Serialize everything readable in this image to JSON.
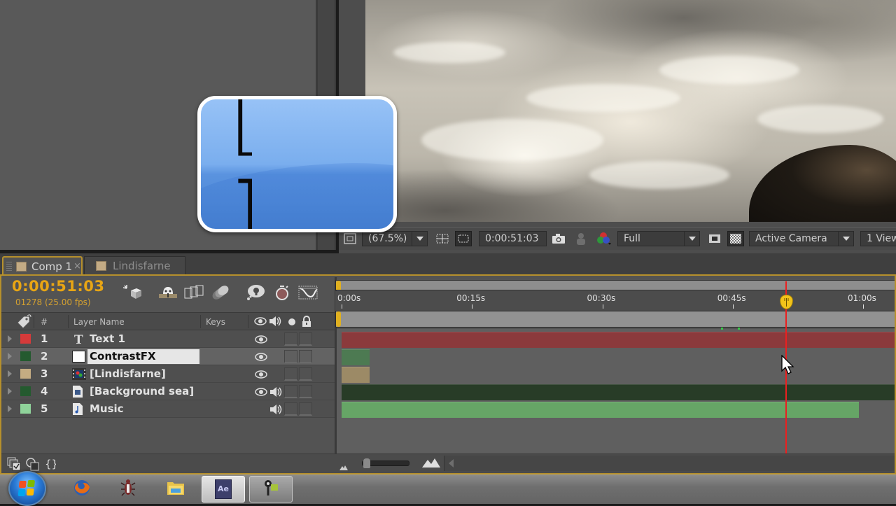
{
  "viewer": {
    "zoom_label": "(67.5%)",
    "timecode": "0:00:51:03",
    "resolution": "Full",
    "camera": "Active Camera",
    "views": "1 View"
  },
  "overlay": {
    "key_hint": "[   ]"
  },
  "tabs": [
    {
      "label": "Comp 1",
      "active": true,
      "close": "×"
    },
    {
      "label": "Lindisfarne",
      "active": false
    }
  ],
  "timeline": {
    "current_time": "0:00:51:03",
    "frame_info": "01278 (25.00 fps)",
    "columns": {
      "number": "#",
      "layer_name": "Layer Name",
      "keys": "Keys"
    },
    "ruler": {
      "ticks": [
        "0:00s",
        "00:15s",
        "00:30s",
        "00:45s",
        "01:00s"
      ],
      "tick_seconds": [
        0,
        15,
        30,
        45,
        60
      ],
      "playhead_seconds": 51.12,
      "visible_range_seconds": [
        0,
        64
      ]
    },
    "layers": [
      {
        "num": "1",
        "name": "Text 1",
        "type": "text",
        "label_color": "#d63a3a",
        "bar_color": "#8b3a3c",
        "start": 0,
        "end": 64,
        "eye": true,
        "audio": false,
        "selected": false
      },
      {
        "num": "2",
        "name": "ContrastFX",
        "type": "solid",
        "label_color": "#245a2f",
        "bar_color": "#4d7a52",
        "start": 0,
        "end": 3.2,
        "eye": true,
        "audio": false,
        "selected": true
      },
      {
        "num": "3",
        "name": "[Lindisfarne]",
        "type": "comp",
        "label_color": "#c4ac82",
        "bar_color": "#9c8a66",
        "start": 0,
        "end": 3.2,
        "eye": true,
        "audio": false,
        "selected": false
      },
      {
        "num": "4",
        "name": "[Background sea]",
        "type": "video",
        "label_color": "#245a2f",
        "bar_color": "#283c27",
        "start": 0,
        "end": 64,
        "eye": true,
        "audio": true,
        "selected": false
      },
      {
        "num": "5",
        "name": "Music",
        "type": "audio",
        "label_color": "#8fd39a",
        "bar_color": "#66a566",
        "start": 0,
        "end": 59.5,
        "eye": false,
        "audio": true,
        "selected": false
      }
    ],
    "zoom_slider_value": 0.05
  },
  "taskbar": {
    "items": [
      {
        "name": "firefox",
        "state": "pinned"
      },
      {
        "name": "bug-app",
        "state": "pinned"
      },
      {
        "name": "file-explorer",
        "state": "pinned"
      },
      {
        "name": "after-effects",
        "label": "Ae",
        "state": "active"
      },
      {
        "name": "key-tool",
        "state": "open"
      }
    ]
  }
}
